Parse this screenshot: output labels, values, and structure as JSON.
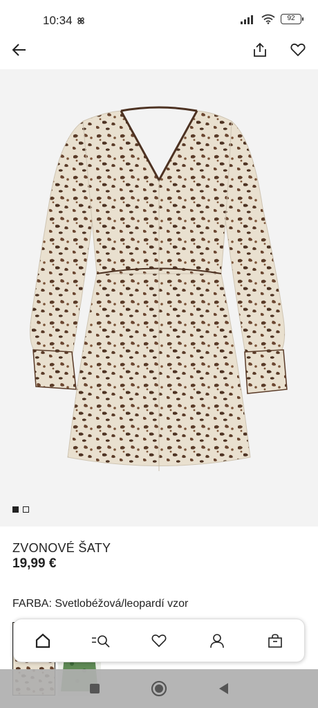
{
  "status_bar": {
    "time": "10:34",
    "battery": "92"
  },
  "top_bar": {
    "back_icon": "arrow-left-icon",
    "share_icon": "share-icon",
    "favorite_icon": "heart-icon"
  },
  "gallery": {
    "image_count": 2,
    "current_index": 1
  },
  "product": {
    "name": "ZVONOVÉ ŠATY",
    "price": "19,99 €",
    "color_label": "FARBA:",
    "color_value": "Svetlobéžová/leopardí vzor"
  },
  "bottom_nav": {
    "items": [
      {
        "icon": "home-icon"
      },
      {
        "icon": "search-menu-icon"
      },
      {
        "icon": "heart-icon"
      },
      {
        "icon": "account-icon"
      },
      {
        "icon": "shopping-bag-icon"
      }
    ]
  },
  "colors": {
    "accent": "#222222",
    "image_background": "#f3f3f3",
    "leopard_base": "#e9e0cf",
    "leopard_spot": "#5a3b28"
  }
}
